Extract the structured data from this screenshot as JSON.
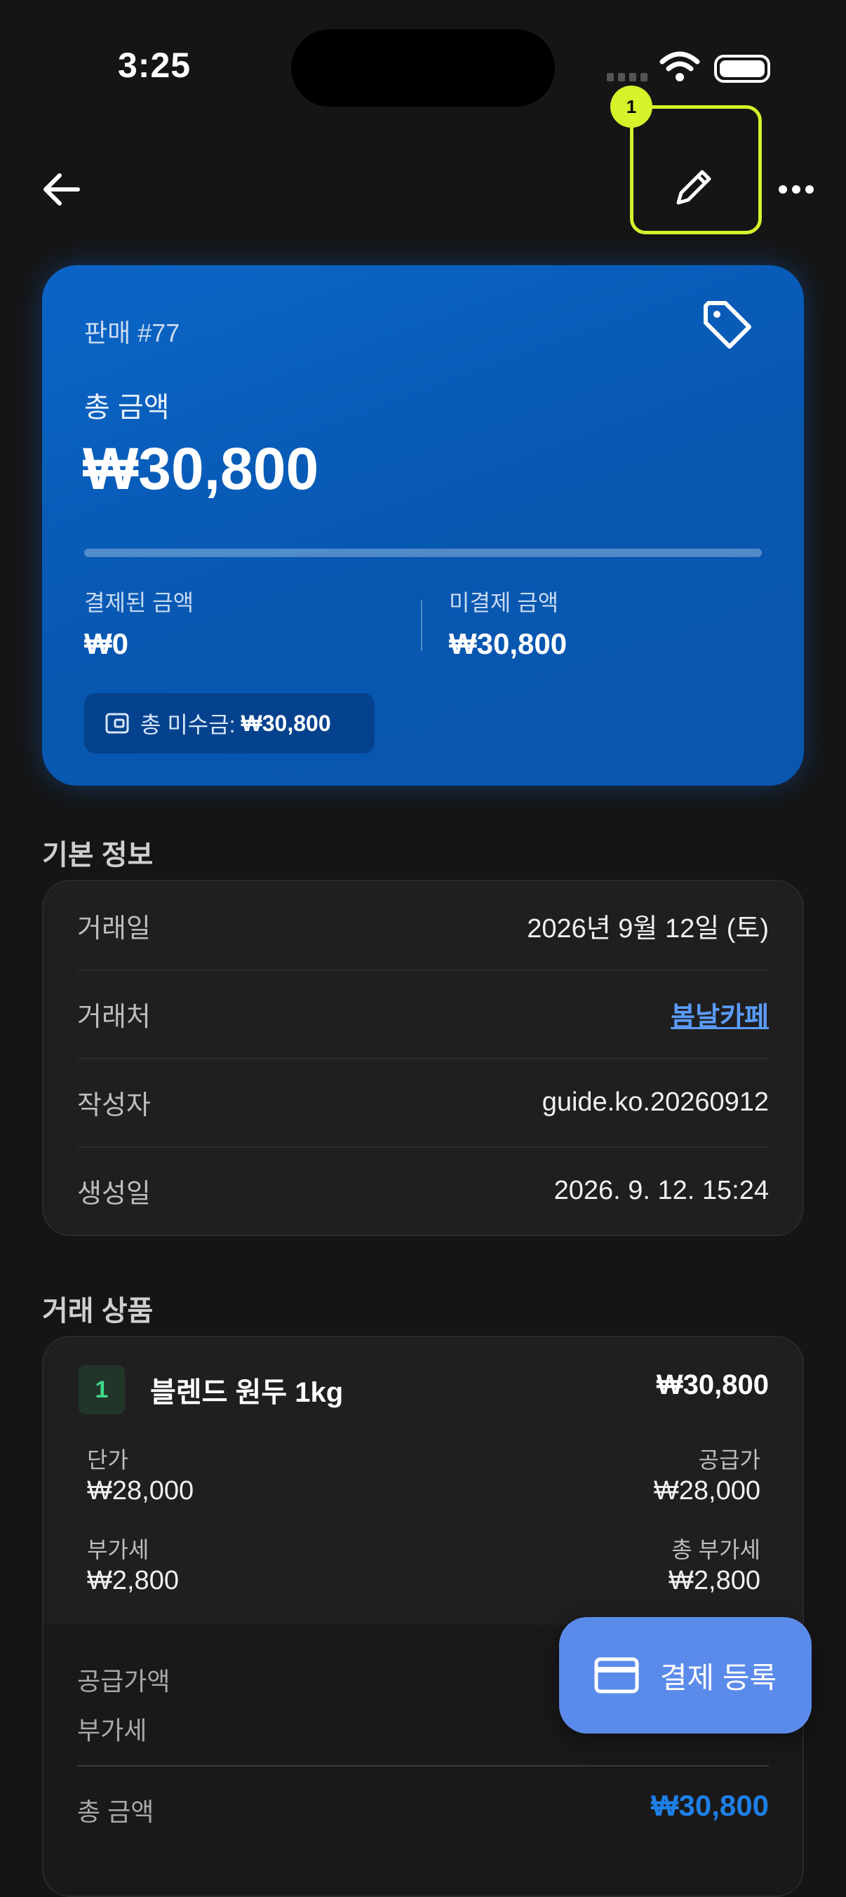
{
  "status": {
    "time": "3:25"
  },
  "nav": {
    "edit_badge": "1"
  },
  "hero": {
    "subtitle": "판매 #77",
    "total_label": "총 금액",
    "total_amount": "₩30,800",
    "paid_progress": 0,
    "paid_label": "결제된 금액",
    "paid_value": "₩0",
    "due_label": "미결제 금액",
    "due_value": "₩30,800",
    "receivable_label": "총 미수금:",
    "receivable_value": "₩30,800"
  },
  "info": {
    "title": "기본 정보",
    "rows": [
      {
        "key": "거래일",
        "value": "2026년 9월 12일 (토)"
      },
      {
        "key": "거래처",
        "value": "봄날카페"
      },
      {
        "key": "작성자",
        "value": "guide.ko.20260912"
      },
      {
        "key": "생성일",
        "value": "2026. 9. 12. 15:24"
      }
    ]
  },
  "products": {
    "title": "거래 상품",
    "items": [
      {
        "index": "1",
        "name": "블렌드 원두 1kg",
        "total": "₩30,800",
        "unit_price_label": "단가",
        "unit_price": "₩28,000",
        "supply_label": "공급가",
        "supply": "₩28,000",
        "vat_label": "부가세",
        "vat": "₩2,800",
        "total_vat_label": "총 부가세",
        "total_vat": "₩2,800"
      }
    ],
    "summary": {
      "supply_label": "공급가액",
      "vat_label": "부가세",
      "total_label": "총 금액",
      "total_value": "₩30,800"
    }
  },
  "fab": {
    "label": "결제 등록"
  },
  "colors": {
    "accent": "#0b65c6",
    "highlight": "#d6f22a",
    "link": "#5a9cff",
    "fab": "#5b8bea"
  }
}
